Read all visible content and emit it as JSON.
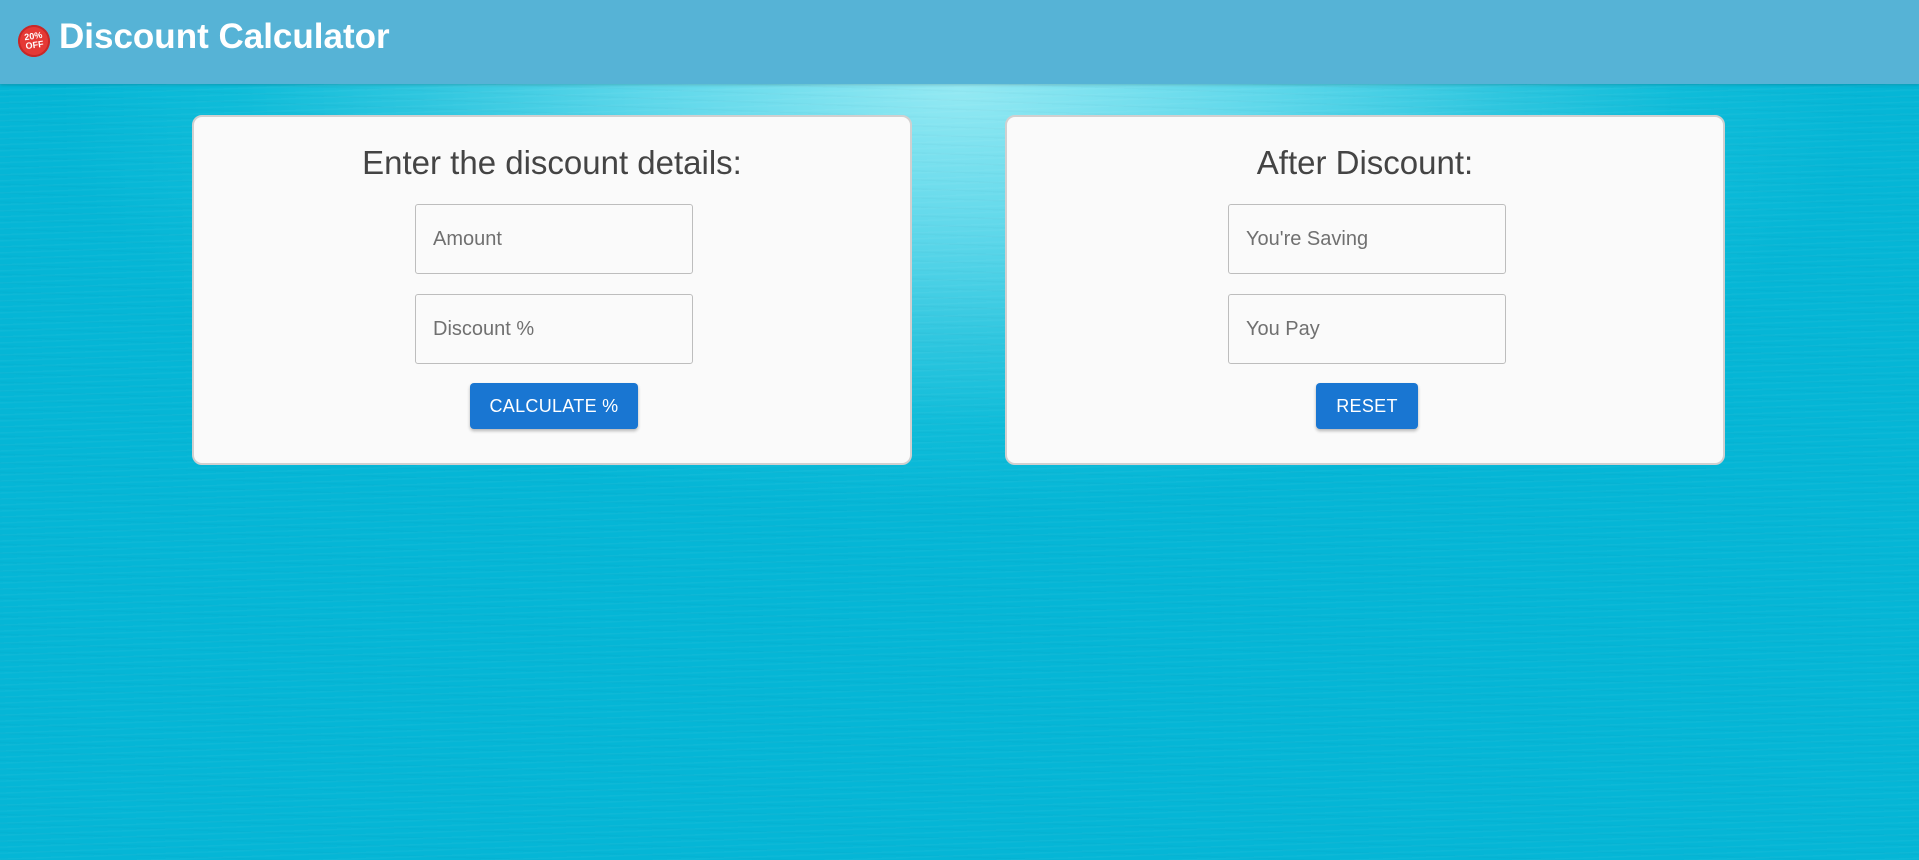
{
  "header": {
    "logo_text_line1": "20%",
    "logo_text_line2": "OFF",
    "logo_color": "#e53935",
    "title": "Discount Calculator",
    "background_color": "#56b3d6"
  },
  "input_card": {
    "heading": "Enter the discount details:",
    "amount_field": {
      "placeholder": "Amount",
      "value": ""
    },
    "discount_field": {
      "placeholder": "Discount %",
      "value": ""
    },
    "calculate_button_label": "CALCULATE %"
  },
  "result_card": {
    "heading": "After Discount:",
    "saving_field": {
      "placeholder": "You're Saving",
      "value": ""
    },
    "pay_field": {
      "placeholder": "You Pay",
      "value": ""
    },
    "reset_button_label": "RESET"
  },
  "colors": {
    "button": "#1976d2",
    "card_background": "#fafafa",
    "page_background": "#0fbcd9"
  }
}
